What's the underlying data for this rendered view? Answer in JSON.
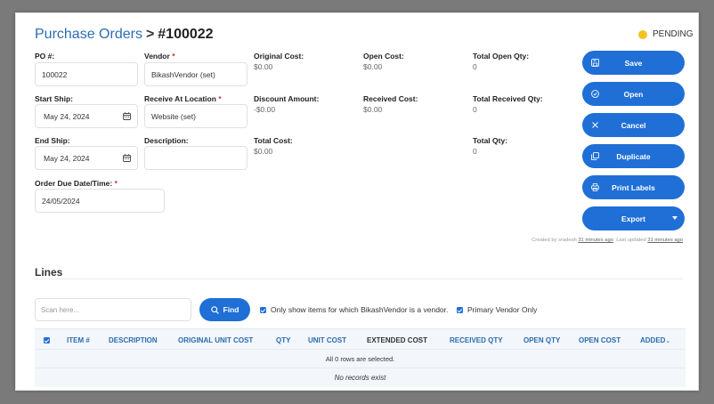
{
  "breadcrumb": {
    "parent": "Purchase Orders",
    "separator": ">",
    "current": "#100022"
  },
  "status": {
    "label": "PENDING",
    "color": "#f4c21f"
  },
  "fields": {
    "po_label": "PO #:",
    "po_value": "100022",
    "vendor_label": "Vendor",
    "vendor_value": "BikashVendor  (set)",
    "start_ship_label": "Start Ship:",
    "start_ship_value": "May 24, 2024",
    "receive_label": "Receive At Location",
    "receive_value": "Website  (set)",
    "end_ship_label": "End Ship:",
    "end_ship_value": "May 24, 2024",
    "description_label": "Description:",
    "description_value": "",
    "order_due_label": "Order Due Date/Time:",
    "order_due_value": "24/05/2024",
    "required_marker": "*"
  },
  "summary": {
    "original_cost_label": "Original Cost:",
    "original_cost_value": "$0.00",
    "open_cost_label": "Open Cost:",
    "open_cost_value": "$0.00",
    "total_open_qty_label": "Total Open Qty:",
    "total_open_qty_value": "0",
    "discount_label": "Discount Amount:",
    "discount_value": "-$0.00",
    "received_cost_label": "Received Cost:",
    "received_cost_value": "$0.00",
    "total_received_qty_label": "Total Received Qty:",
    "total_received_qty_value": "0",
    "total_cost_label": "Total Cost:",
    "total_cost_value": "$0.00",
    "total_qty_label": "Total Qty:",
    "total_qty_value": "0"
  },
  "actions": {
    "save": "Save",
    "open": "Open",
    "cancel": "Cancel",
    "duplicate": "Duplicate",
    "print_labels": "Print Labels",
    "export": "Export"
  },
  "meta": {
    "created_by_prefix": "Created by sradesh",
    "created_time": "31 minutes ago",
    "updated_prefix": "Last updated",
    "updated_time": "31 minutes ago"
  },
  "lines": {
    "title": "Lines",
    "scan_placeholder": "Scan here...",
    "find_label": "Find",
    "only_vendor_label": "Only show items for which BikashVendor is a vendor.",
    "primary_vendor_label": "Primary Vendor Only",
    "columns": [
      "ITEM #",
      "DESCRIPTION",
      "ORIGINAL UNIT COST",
      "QTY",
      "UNIT COST",
      "EXTENDED COST",
      "RECEIVED QTY",
      "OPEN QTY",
      "OPEN COST",
      "ADDED"
    ],
    "added_sort_glyph": "⌄",
    "selection_text": "All 0 rows are selected.",
    "empty_text": "No records exist"
  }
}
